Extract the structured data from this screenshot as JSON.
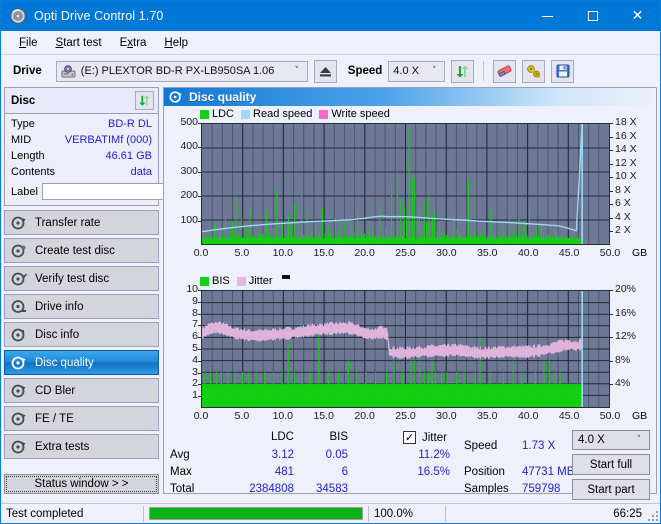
{
  "window": {
    "title": "Opti Drive Control 1.70",
    "icon": "disc-icon",
    "minimize": "–",
    "maximize": "□",
    "close": "✕"
  },
  "menu": {
    "items": [
      {
        "label": "File",
        "accel": "F"
      },
      {
        "label": "Start test",
        "accel": "S"
      },
      {
        "label": "Extra",
        "accel": "x"
      },
      {
        "label": "Help",
        "accel": "H"
      }
    ]
  },
  "toolbar": {
    "drive_label": "Drive",
    "drive_value": "(E:)   PLEXTOR BD-R  PX-LB950SA 1.06",
    "eject_icon": "eject-icon",
    "speed_label": "Speed",
    "speed_value": "4.0 X",
    "refresh_icon": "refresh-icon",
    "erase_icon": "eraser-icon",
    "tools_icon": "tools-icon",
    "save_icon": "floppy-save-icon"
  },
  "sidebar": {
    "disc_panel": {
      "title": "Disc",
      "refresh_icon": "refresh-icon",
      "rows": [
        {
          "key": "Type",
          "value": "BD-R DL"
        },
        {
          "key": "MID",
          "value": "VERBATIMf (000)"
        },
        {
          "key": "Length",
          "value": "46.61 GB"
        },
        {
          "key": "Contents",
          "value": "data"
        }
      ],
      "label_key": "Label",
      "label_value": "",
      "label_placeholder": "",
      "disc_icon": "cd-disc-icon"
    },
    "nav": [
      {
        "label": "Transfer rate",
        "icon": "disc-test-icon",
        "active": false
      },
      {
        "label": "Create test disc",
        "icon": "disc-burn-icon",
        "active": false
      },
      {
        "label": "Verify test disc",
        "icon": "disc-verify-icon",
        "active": false
      },
      {
        "label": "Drive info",
        "icon": "drive-info-icon",
        "active": false
      },
      {
        "label": "Disc info",
        "icon": "disc-info-icon",
        "active": false
      },
      {
        "label": "Disc quality",
        "icon": "disc-quality-icon",
        "active": true
      },
      {
        "label": "CD Bler",
        "icon": "cd-bler-icon",
        "active": false
      },
      {
        "label": "FE / TE",
        "icon": "fe-te-icon",
        "active": false
      },
      {
        "label": "Extra tests",
        "icon": "extra-tests-icon",
        "active": false
      }
    ],
    "status_window_button": "Status window > >"
  },
  "content": {
    "header_title": "Disc quality",
    "header_icon": "disc-quality-icon"
  },
  "stats": {
    "col_ldc": "LDC",
    "col_bis": "BIS",
    "jitter_label": "Jitter",
    "jitter_checked": true,
    "row_avg": "Avg",
    "row_max": "Max",
    "row_total": "Total",
    "ldc_avg": "3.12",
    "ldc_max": "481",
    "ldc_total": "2384808",
    "bis_avg": "0.05",
    "bis_max": "6",
    "bis_total": "34583",
    "jitter_avg": "11.2%",
    "jitter_max": "16.5%",
    "speed_label": "Speed",
    "speed_value": "1.73 X",
    "position_label": "Position",
    "position_value": "47731 MB",
    "samples_label": "Samples",
    "samples_value": "759798",
    "speed_select": "4.0 X",
    "start_full": "Start full",
    "start_part": "Start part"
  },
  "statusbar": {
    "message": "Test completed",
    "percent_text": "100.0%",
    "percent_value": 100,
    "elapsed": "66:25"
  },
  "colors": {
    "accent": "#0078d7",
    "plot_bg": "#6c7895",
    "ldc_green": "#13cf13",
    "bis_green": "#13cf13",
    "read_speed": "#9fd8f5",
    "write_speed": "#ff66cc",
    "jitter_pink": "#e6b7e0",
    "value_blue": "#2222cc",
    "progress_green": "#0ab215"
  },
  "chart_data": [
    {
      "type": "line",
      "name": "disc-quality-ldc-chart",
      "title": "",
      "xlabel": "GB",
      "ylabel": "LDC",
      "y2label": "X",
      "xlim": [
        0,
        50
      ],
      "ylim": [
        0,
        500
      ],
      "y2lim": [
        0,
        18
      ],
      "grid": true,
      "legend_position": "top-left",
      "legend": [
        "LDC",
        "Read speed",
        "Write speed"
      ],
      "xticks": [
        "0.0",
        "5.0",
        "10.0",
        "15.0",
        "20.0",
        "25.0",
        "30.0",
        "35.0",
        "40.0",
        "45.0",
        "50.0"
      ],
      "yticks": [
        "100",
        "200",
        "300",
        "400",
        "500"
      ],
      "y2ticks": [
        "2 X",
        "4 X",
        "6 X",
        "8 X",
        "10 X",
        "12 X",
        "14 X",
        "16 X",
        "18 X"
      ],
      "data_end_gb": 46.7,
      "series": [
        {
          "name": "LDC",
          "color": "#13cf13",
          "kind": "spikes",
          "baseline": 22,
          "values": [
            28,
            34,
            25,
            40,
            22,
            55,
            30,
            26,
            48,
            24,
            31,
            90,
            26,
            33,
            22,
            45,
            28,
            60,
            24,
            30,
            120,
            26,
            36,
            22,
            54,
            28,
            95,
            24,
            32,
            200,
            28,
            45,
            22,
            30,
            110,
            26,
            38,
            24,
            62,
            30,
            26,
            150,
            22,
            40,
            28,
            34,
            22,
            26,
            55,
            30,
            36,
            24,
            44,
            28,
            30,
            140,
            22,
            48,
            26,
            34,
            22,
            65,
            28,
            30,
            230,
            24,
            45,
            32,
            26,
            95,
            22,
            38,
            28,
            30,
            120,
            24,
            60,
            26,
            34,
            170,
            28,
            22,
            48,
            30,
            26,
            215,
            22,
            40,
            28,
            34,
            130,
            24,
            38,
            26,
            55,
            30,
            24,
            90,
            28,
            22,
            46,
            30,
            26,
            150,
            22,
            38,
            28,
            30,
            70,
            24,
            48,
            26,
            34,
            22,
            110,
            28,
            30,
            60,
            24,
            44,
            26,
            22,
            95,
            30,
            28,
            38,
            24,
            30,
            80,
            26,
            48,
            22,
            34,
            130,
            28,
            24,
            56,
            30,
            26,
            44,
            22,
            38,
            28,
            90,
            30,
            24,
            62,
            26,
            34,
            22,
            48,
            28,
            160,
            30,
            24,
            44,
            26,
            70,
            22,
            38,
            28,
            30,
            250,
            24,
            56,
            26,
            34,
            300,
            28,
            22,
            190,
            30,
            26,
            160,
            22,
            110,
            28,
            480,
            30,
            24,
            270,
            26,
            290,
            22,
            110,
            28,
            150,
            30,
            60,
            24,
            180,
            26,
            90,
            22,
            200,
            28,
            30,
            120,
            24,
            140,
            26,
            55,
            22,
            90,
            28,
            60,
            30,
            44,
            24,
            38,
            26,
            34,
            22,
            30,
            28,
            120,
            30,
            26,
            60,
            22,
            44,
            28,
            38,
            24,
            34,
            26,
            30,
            22,
            270,
            28,
            36,
            30,
            26,
            48,
            22,
            34,
            28,
            30,
            44,
            24,
            38,
            26,
            60,
            22,
            34,
            28,
            30,
            140,
            24,
            44,
            26,
            38,
            22,
            55,
            28,
            34,
            30,
            26,
            80,
            22,
            44,
            28,
            30,
            120,
            24,
            38,
            26,
            60,
            22,
            34,
            28,
            110,
            30,
            26,
            44,
            22,
            95,
            28,
            36,
            24,
            160,
            26,
            48,
            22,
            38,
            28,
            60,
            30,
            34,
            24,
            80,
            26,
            44,
            22,
            30,
            28,
            38,
            24,
            34,
            26,
            30,
            22,
            60,
            28,
            44,
            30,
            26,
            38,
            22,
            34,
            28,
            30,
            24,
            26,
            22,
            28,
            30,
            24,
            26,
            22,
            28,
            30,
            24,
            26,
            22
          ]
        },
        {
          "name": "Read speed",
          "color": "#9fd8f5",
          "kind": "line",
          "x": [
            0,
            2,
            4,
            6,
            8,
            10,
            12,
            14,
            16,
            18,
            20,
            21,
            22,
            23,
            24,
            25,
            26,
            27,
            28,
            30,
            32,
            34,
            36,
            38,
            40,
            42,
            44,
            46,
            46.7
          ],
          "values": [
            1.85,
            2.2,
            2.5,
            2.75,
            2.95,
            3.1,
            3.25,
            3.4,
            3.5,
            3.6,
            3.85,
            4.05,
            4.15,
            4.1,
            4.12,
            4.1,
            4.05,
            3.95,
            3.85,
            3.7,
            3.6,
            3.45,
            3.3,
            3.2,
            3.05,
            2.9,
            2.7,
            2.0,
            18.0
          ]
        },
        {
          "name": "Write speed",
          "color": "#ff66cc",
          "kind": "line",
          "x": [],
          "values": []
        }
      ]
    },
    {
      "type": "line",
      "name": "disc-quality-bis-jitter-chart",
      "title": "",
      "xlabel": "GB",
      "ylabel": "BIS",
      "y2label": "%",
      "xlim": [
        0,
        50
      ],
      "ylim": [
        0,
        10
      ],
      "y2lim": [
        0,
        20
      ],
      "grid": true,
      "legend_position": "top-left",
      "legend": [
        "BIS",
        "Jitter"
      ],
      "xticks": [
        "0.0",
        "5.0",
        "10.0",
        "15.0",
        "20.0",
        "25.0",
        "30.0",
        "35.0",
        "40.0",
        "45.0",
        "50.0"
      ],
      "yticks": [
        "1",
        "2",
        "3",
        "4",
        "5",
        "6",
        "7",
        "8",
        "9",
        "10"
      ],
      "y2ticks": [
        "4%",
        "8%",
        "12%",
        "16%",
        "20%"
      ],
      "data_end_gb": 46.7,
      "series": [
        {
          "name": "BIS",
          "color": "#13cf13",
          "kind": "spikes",
          "baseline": 1.9,
          "values": [
            2,
            2,
            3,
            2,
            2,
            2,
            2,
            3,
            2,
            2,
            2,
            2,
            3,
            2,
            2,
            2,
            3,
            2,
            2,
            2,
            2,
            3,
            2,
            2,
            2,
            2,
            2,
            3,
            2,
            2,
            2,
            2,
            2,
            3,
            2,
            2,
            2,
            2,
            3,
            2,
            2,
            2,
            2,
            2,
            3,
            2,
            2,
            2,
            2,
            2,
            2,
            3,
            2,
            2,
            2,
            2,
            2,
            2,
            3,
            2,
            2,
            2,
            2,
            2,
            2,
            3,
            2,
            2,
            2,
            2,
            5.6,
            2,
            2,
            2,
            2,
            3,
            2,
            2,
            2,
            2,
            2,
            3,
            2,
            2,
            2,
            2,
            2,
            2,
            3,
            2,
            2,
            2,
            2,
            2,
            2,
            6,
            2,
            2,
            2,
            2,
            2,
            2,
            2,
            3,
            2,
            2,
            2,
            2,
            2,
            2,
            2,
            3,
            2,
            2,
            2,
            2,
            2,
            2,
            2,
            4,
            2,
            2,
            2,
            2,
            2,
            2,
            3,
            2,
            2,
            2,
            2,
            2,
            2,
            3,
            2,
            2,
            2,
            2,
            2,
            2,
            2,
            3,
            2,
            2,
            2,
            2,
            2,
            2,
            2,
            2,
            3,
            2,
            2,
            2,
            2,
            2,
            4,
            2,
            2,
            2,
            2,
            2,
            2,
            3,
            2,
            2,
            2,
            2,
            2,
            2,
            4,
            2,
            2,
            4,
            2,
            2,
            2,
            4,
            2,
            2,
            2,
            3,
            2,
            2,
            3,
            2,
            2,
            4,
            2,
            2,
            3,
            2,
            2,
            2,
            2,
            3,
            2,
            2,
            2,
            3,
            2,
            2,
            2,
            2,
            2,
            2,
            2,
            3,
            2,
            2,
            2,
            2,
            2,
            3,
            2,
            2,
            2,
            2,
            2,
            2,
            2,
            2,
            3,
            2,
            2,
            2,
            6,
            2,
            2,
            2,
            2,
            2,
            2,
            2,
            3,
            2,
            2,
            2,
            2,
            2,
            2,
            2,
            2,
            2,
            2,
            3,
            2,
            2,
            2,
            2,
            2,
            2,
            2,
            4,
            2,
            2,
            2,
            2,
            2,
            2,
            3,
            2,
            2,
            2,
            2,
            2,
            2,
            2,
            2,
            2,
            2,
            3,
            2,
            2,
            2,
            2,
            2,
            2,
            4,
            2,
            2,
            2,
            4,
            2,
            2,
            2,
            2,
            3,
            2,
            2,
            2,
            3,
            2,
            2,
            2,
            2,
            2,
            2,
            2,
            2,
            2,
            2,
            2,
            2,
            2,
            2,
            2,
            2,
            2
          ]
        },
        {
          "name": "Jitter",
          "color": "#e6b7e0",
          "kind": "band",
          "x": [
            0,
            1,
            2,
            3,
            4,
            5,
            6,
            7,
            8,
            9,
            10,
            11,
            12,
            13,
            14,
            15,
            16,
            17,
            18,
            19,
            20,
            21,
            22,
            22.8,
            23,
            24,
            25,
            26,
            27,
            28,
            29,
            30,
            31,
            32,
            33,
            34,
            35,
            36,
            37,
            38,
            39,
            40,
            41,
            42,
            43,
            44,
            45,
            46,
            46.7
          ],
          "values": [
            12.6,
            13.4,
            13.6,
            13.2,
            12.6,
            12.4,
            12.2,
            12.2,
            12.3,
            12.4,
            12.5,
            12.6,
            12.8,
            13.0,
            13.2,
            13.3,
            13.4,
            13.5,
            13.5,
            13.2,
            12.6,
            12.4,
            12.8,
            12.4,
            9.4,
            9.2,
            9.2,
            9.3,
            9.4,
            9.5,
            9.6,
            9.6,
            9.7,
            9.6,
            9.4,
            9.2,
            9.2,
            9.3,
            9.4,
            9.4,
            9.4,
            9.4,
            9.5,
            9.7,
            10.0,
            10.4,
            10.6,
            10.4,
            10.8
          ]
        }
      ]
    }
  ]
}
